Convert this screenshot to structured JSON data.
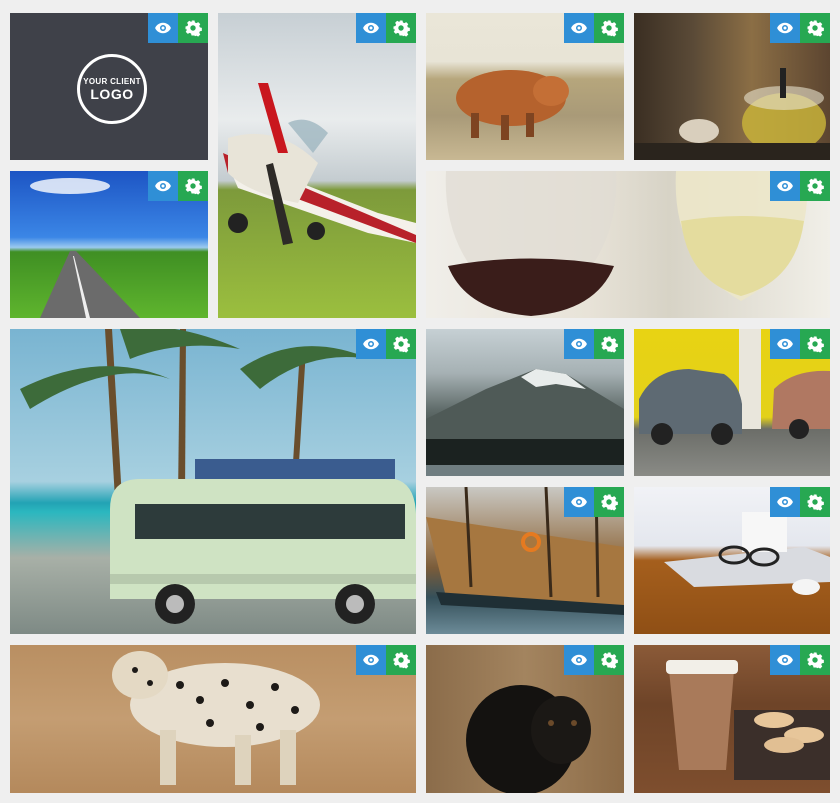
{
  "logo": {
    "line1": "YOUR CLIENT",
    "line2": "LOGO"
  },
  "colors": {
    "view_button": "#2f8fd6",
    "settings_button": "#27a852",
    "background": "#efefef"
  },
  "icons": {
    "view": "eye-icon",
    "settings": "gear-icon"
  },
  "tiles": [
    {
      "id": "logo",
      "subject": "client logo placeholder"
    },
    {
      "id": "plane",
      "subject": "propeller airplane"
    },
    {
      "id": "cow",
      "subject": "highland cow"
    },
    {
      "id": "tea",
      "subject": "teapot and cup"
    },
    {
      "id": "road",
      "subject": "road through field"
    },
    {
      "id": "wine",
      "subject": "wine glasses"
    },
    {
      "id": "bus",
      "subject": "vintage bus under palms"
    },
    {
      "id": "mountain",
      "subject": "mountain lake"
    },
    {
      "id": "cars",
      "subject": "classic cars"
    },
    {
      "id": "boat",
      "subject": "sailing boat"
    },
    {
      "id": "desk",
      "subject": "laptop on desk"
    },
    {
      "id": "leopard",
      "subject": "leopard"
    },
    {
      "id": "dog",
      "subject": "black puppy"
    },
    {
      "id": "coffee",
      "subject": "coffee cup and macarons"
    }
  ]
}
